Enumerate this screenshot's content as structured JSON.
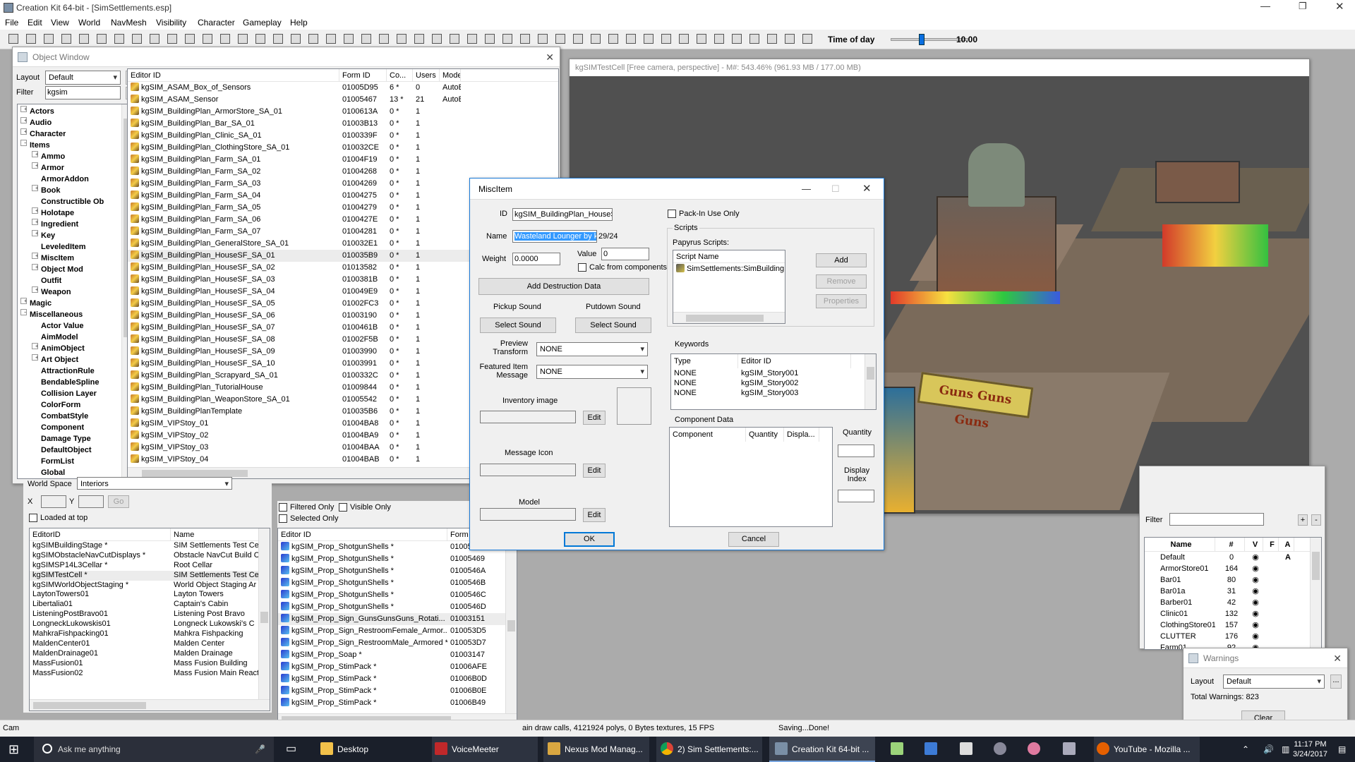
{
  "app": {
    "title": "Creation Kit 64-bit - [SimSettlements.esp]",
    "menu": [
      "File",
      "Edit",
      "View",
      "World",
      "NavMesh",
      "Visibility",
      "Character",
      "Gameplay",
      "Help"
    ]
  },
  "toolbar": {
    "time_label": "Time of day",
    "time_value": "10.00",
    "time_fraction": 0.39
  },
  "object_window": {
    "title": "Object Window",
    "layout_label": "Layout",
    "layout_value": "Default",
    "filter_label": "Filter",
    "filter_value": "kgsim",
    "tree": [
      {
        "label": "Actors",
        "sign": "+",
        "indent": 0
      },
      {
        "label": "Audio",
        "sign": "+",
        "indent": 0
      },
      {
        "label": "Character",
        "sign": "+",
        "indent": 0
      },
      {
        "label": "Items",
        "sign": "−",
        "indent": 0
      },
      {
        "label": "Ammo",
        "sign": "+",
        "indent": 1
      },
      {
        "label": "Armor",
        "sign": "+",
        "indent": 1
      },
      {
        "label": "ArmorAddon",
        "sign": "",
        "indent": 1
      },
      {
        "label": "Book",
        "sign": "+",
        "indent": 1
      },
      {
        "label": "Constructible Ob",
        "sign": "",
        "indent": 1
      },
      {
        "label": "Holotape",
        "sign": "+",
        "indent": 1
      },
      {
        "label": "Ingredient",
        "sign": "+",
        "indent": 1
      },
      {
        "label": "Key",
        "sign": "+",
        "indent": 1
      },
      {
        "label": "LeveledItem",
        "sign": "",
        "indent": 1
      },
      {
        "label": "MiscItem",
        "sign": "+",
        "indent": 1
      },
      {
        "label": "Object Mod",
        "sign": "+",
        "indent": 1
      },
      {
        "label": "Outfit",
        "sign": "",
        "indent": 1
      },
      {
        "label": "Weapon",
        "sign": "+",
        "indent": 1
      },
      {
        "label": "Magic",
        "sign": "+",
        "indent": 0
      },
      {
        "label": "Miscellaneous",
        "sign": "−",
        "indent": 0
      },
      {
        "label": "Actor Value",
        "sign": "",
        "indent": 1
      },
      {
        "label": "AimModel",
        "sign": "",
        "indent": 1
      },
      {
        "label": "AnimObject",
        "sign": "+",
        "indent": 1
      },
      {
        "label": "Art Object",
        "sign": "+",
        "indent": 1
      },
      {
        "label": "AttractionRule",
        "sign": "",
        "indent": 1
      },
      {
        "label": "BendableSpline",
        "sign": "",
        "indent": 1
      },
      {
        "label": "Collision Layer",
        "sign": "",
        "indent": 1
      },
      {
        "label": "ColorForm",
        "sign": "",
        "indent": 1
      },
      {
        "label": "CombatStyle",
        "sign": "",
        "indent": 1
      },
      {
        "label": "Component",
        "sign": "",
        "indent": 1
      },
      {
        "label": "Damage Type",
        "sign": "",
        "indent": 1
      },
      {
        "label": "DefaultObject",
        "sign": "",
        "indent": 1
      },
      {
        "label": "FormList",
        "sign": "",
        "indent": 1
      },
      {
        "label": "Global",
        "sign": "",
        "indent": 1
      }
    ],
    "columns": [
      "Editor ID",
      "Form ID",
      "Co...",
      "Users",
      "Model"
    ],
    "rows": [
      [
        "kgSIM_ASAM_Box_of_Sensors",
        "01005D95",
        "6 *",
        "0",
        "AutoBu"
      ],
      [
        "kgSIM_ASAM_Sensor",
        "01005467",
        "13 *",
        "21",
        "AutoBu"
      ],
      [
        "kgSIM_BuildingPlan_ArmorStore_SA_01",
        "0100613A",
        "0 *",
        "1",
        ""
      ],
      [
        "kgSIM_BuildingPlan_Bar_SA_01",
        "01003B13",
        "0 *",
        "1",
        ""
      ],
      [
        "kgSIM_BuildingPlan_Clinic_SA_01",
        "0100339F",
        "0 *",
        "1",
        ""
      ],
      [
        "kgSIM_BuildingPlan_ClothingStore_SA_01",
        "010032CE",
        "0 *",
        "1",
        ""
      ],
      [
        "kgSIM_BuildingPlan_Farm_SA_01",
        "01004F19",
        "0 *",
        "1",
        ""
      ],
      [
        "kgSIM_BuildingPlan_Farm_SA_02",
        "01004268",
        "0 *",
        "1",
        ""
      ],
      [
        "kgSIM_BuildingPlan_Farm_SA_03",
        "01004269",
        "0 *",
        "1",
        ""
      ],
      [
        "kgSIM_BuildingPlan_Farm_SA_04",
        "01004275",
        "0 *",
        "1",
        ""
      ],
      [
        "kgSIM_BuildingPlan_Farm_SA_05",
        "01004279",
        "0 *",
        "1",
        ""
      ],
      [
        "kgSIM_BuildingPlan_Farm_SA_06",
        "0100427E",
        "0 *",
        "1",
        ""
      ],
      [
        "kgSIM_BuildingPlan_Farm_SA_07",
        "01004281",
        "0 *",
        "1",
        ""
      ],
      [
        "kgSIM_BuildingPlan_GeneralStore_SA_01",
        "010032E1",
        "0 *",
        "1",
        ""
      ],
      [
        "kgSIM_BuildingPlan_HouseSF_SA_01",
        "010035B9",
        "0 *",
        "1",
        ""
      ],
      [
        "kgSIM_BuildingPlan_HouseSF_SA_02",
        "01013582",
        "0 *",
        "1",
        ""
      ],
      [
        "kgSIM_BuildingPlan_HouseSF_SA_03",
        "0100381B",
        "0 *",
        "1",
        ""
      ],
      [
        "kgSIM_BuildingPlan_HouseSF_SA_04",
        "010049E9",
        "0 *",
        "1",
        ""
      ],
      [
        "kgSIM_BuildingPlan_HouseSF_SA_05",
        "01002FC3",
        "0 *",
        "1",
        ""
      ],
      [
        "kgSIM_BuildingPlan_HouseSF_SA_06",
        "01003190",
        "0 *",
        "1",
        ""
      ],
      [
        "kgSIM_BuildingPlan_HouseSF_SA_07",
        "0100461B",
        "0 *",
        "1",
        ""
      ],
      [
        "kgSIM_BuildingPlan_HouseSF_SA_08",
        "01002F5B",
        "0 *",
        "1",
        ""
      ],
      [
        "kgSIM_BuildingPlan_HouseSF_SA_09",
        "01003990",
        "0 *",
        "1",
        ""
      ],
      [
        "kgSIM_BuildingPlan_HouseSF_SA_10",
        "01003991",
        "0 *",
        "1",
        ""
      ],
      [
        "kgSIM_BuildingPlan_Scrapyard_SA_01",
        "0100332C",
        "0 *",
        "1",
        ""
      ],
      [
        "kgSIM_BuildingPlan_TutorialHouse",
        "01009844",
        "0 *",
        "1",
        ""
      ],
      [
        "kgSIM_BuildingPlan_WeaponStore_SA_01",
        "01005542",
        "0 *",
        "1",
        ""
      ],
      [
        "kgSIM_BuildingPlanTemplate",
        "010035B6",
        "0 *",
        "1",
        ""
      ],
      [
        "kgSIM_VIPStoy_01",
        "01004BA8",
        "0 *",
        "1",
        ""
      ],
      [
        "kgSIM_VIPStoy_02",
        "01004BA9",
        "0 *",
        "1",
        ""
      ],
      [
        "kgSIM_VIPStoy_03",
        "01004BAA",
        "0 *",
        "1",
        ""
      ],
      [
        "kgSIM_VIPStoy_04",
        "01004BAB",
        "0 *",
        "1",
        ""
      ]
    ]
  },
  "cell_view": {
    "world_space_label": "World Space",
    "world_space_value": "Interiors",
    "x_label": "X",
    "y_label": "Y",
    "go": "Go",
    "loaded_at_top": "Loaded at top",
    "columns": [
      "EditorID",
      "Name"
    ],
    "rows": [
      [
        "kgSIMBuildingStage *",
        "SIM Settlements Test Ce"
      ],
      [
        "kgSIMObstacleNavCutDisplays *",
        "Obstacle NavCut Build C"
      ],
      [
        "kgSIMSP14L3Cellar *",
        "Root Cellar"
      ],
      [
        "kgSIMTestCell *",
        "SIM Settlements Test Ce"
      ],
      [
        "kgSIMWorldObjectStaging *",
        "World Object Staging Ar"
      ],
      [
        "LaytonTowers01",
        "Layton Towers"
      ],
      [
        "Libertalia01",
        "Captain's Cabin"
      ],
      [
        "ListeningPostBravo01",
        "Listening Post Bravo"
      ],
      [
        "LongneckLukowskis01",
        "Longneck Lukowski's C"
      ],
      [
        "MahkraFishpacking01",
        "Mahkra Fishpacking"
      ],
      [
        "MaldenCenter01",
        "Malden Center"
      ],
      [
        "MaldenDrainage01",
        "Malden Drainage"
      ],
      [
        "MassFusion01",
        "Mass Fusion Building"
      ],
      [
        "MassFusion02",
        "Mass Fusion Main React"
      ]
    ]
  },
  "ref_list": {
    "filtered_only": "Filtered Only",
    "visible_only": "Visible Only",
    "selected_only": "Selected Only",
    "columns": [
      "Editor ID",
      "Form I"
    ],
    "rows": [
      [
        "kgSIM_Prop_ShotgunShells *",
        "01005468"
      ],
      [
        "kgSIM_Prop_ShotgunShells *",
        "01005469"
      ],
      [
        "kgSIM_Prop_ShotgunShells *",
        "0100546A"
      ],
      [
        "kgSIM_Prop_ShotgunShells *",
        "0100546B"
      ],
      [
        "kgSIM_Prop_ShotgunShells *",
        "0100546C"
      ],
      [
        "kgSIM_Prop_ShotgunShells *",
        "0100546D"
      ],
      [
        "kgSIM_Prop_Sign_GunsGunsGuns_Rotati...",
        "01003151"
      ],
      [
        "kgSIM_Prop_Sign_RestroomFemale_Armor...",
        "010053D5"
      ],
      [
        "kgSIM_Prop_Sign_RestroomMale_Armored *",
        "010053D7"
      ],
      [
        "kgSIM_Prop_Soap *",
        "01003147"
      ],
      [
        "kgSIM_Prop_StimPack *",
        "01006AFE"
      ],
      [
        "kgSIM_Prop_StimPack *",
        "01006B0D"
      ],
      [
        "kgSIM_Prop_StimPack *",
        "01006B0E"
      ],
      [
        "kgSIM_Prop_StimPack *",
        "01006B49"
      ]
    ]
  },
  "render": {
    "title": "kgSIMTestCell [Free camera, perspective] - M#: 543.46% (961.93 MB / 177.00 MB)",
    "sign_text": "Guns Guns Guns"
  },
  "status": {
    "left": "Cam",
    "middle": "ain draw calls, 4121924 polys, 0 Bytes textures, 15 FPS",
    "right": "Saving...Done!"
  },
  "dialog": {
    "title": "MiscItem",
    "id_label": "ID",
    "id_value": "kgSIM_BuildingPlan_HouseSF_SA_",
    "name_label": "Name",
    "name_value": "Wasteland Lounger by kinggath",
    "name_count": "29/24",
    "weight_label": "Weight",
    "weight_value": "0.0000",
    "value_label": "Value",
    "value_value": "0",
    "calc_label": "Calc from components",
    "add_destruction": "Add Destruction Data",
    "pickup_label": "Pickup Sound",
    "putdown_label": "Putdown Sound",
    "select_sound": "Select Sound",
    "preview_label_1": "Preview",
    "preview_label_2": "Transform",
    "preview_value": "NONE",
    "featured_label_1": "Featured Item",
    "featured_label_2": "Message",
    "featured_value": "NONE",
    "inventory_label": "Inventory image",
    "message_icon_label": "Message Icon",
    "model_label": "Model",
    "edit": "Edit",
    "packin_label": "Pack-In Use Only",
    "scripts_label": "Scripts",
    "papyrus_label": "Papyrus Scripts:",
    "script_col": "Script Name",
    "script_item": "SimSettlements:SimBuildingPlan",
    "add": "Add",
    "remove": "Remove",
    "properties": "Properties",
    "keywords_label": "Keywords",
    "kw_columns": [
      "Type",
      "Editor ID"
    ],
    "keywords": [
      [
        "NONE",
        "kgSIM_Story001"
      ],
      [
        "NONE",
        "kgSIM_Story002"
      ],
      [
        "NONE",
        "kgSIM_Story003"
      ]
    ],
    "component_label": "Component Data",
    "comp_columns": [
      "Component",
      "Quantity",
      "Displa..."
    ],
    "quantity_label": "Quantity",
    "display_label_1": "Display",
    "display_label_2": "Index",
    "ok": "OK",
    "cancel": "Cancel"
  },
  "layers": {
    "filter_label": "Filter",
    "columns": [
      "Name",
      "#",
      "V",
      "F",
      "A"
    ],
    "rows": [
      [
        "Default",
        "0",
        "A"
      ],
      [
        "ArmorStore01",
        "164",
        ""
      ],
      [
        "Bar01",
        "80",
        ""
      ],
      [
        "Bar01a",
        "31",
        ""
      ],
      [
        "Barber01",
        "42",
        ""
      ],
      [
        "Clinic01",
        "132",
        ""
      ],
      [
        "ClothingStore01",
        "157",
        ""
      ],
      [
        "CLUTTER",
        "176",
        ""
      ],
      [
        "Farm01",
        "92",
        ""
      ]
    ]
  },
  "warnings": {
    "title": "Warnings",
    "layout_label": "Layout",
    "layout_value": "Default",
    "total": "Total Warnings: 823",
    "clear": "Clear"
  },
  "taskbar": {
    "search": "Ask me anything",
    "items": [
      "Desktop",
      "VoiceMeeter",
      "Nexus Mod Manag...",
      "2) Sim Settlements:...",
      "Creation Kit 64-bit ...",
      "YouTube - Mozilla ..."
    ],
    "time": "11:17 PM",
    "date": "3/24/2017"
  }
}
